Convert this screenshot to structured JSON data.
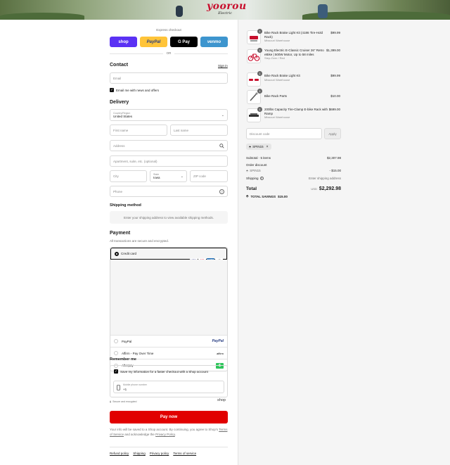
{
  "brand": {
    "name": "yoorou",
    "tagline": "Electric"
  },
  "express": {
    "label": "Express checkout",
    "or": "OR",
    "buttons": [
      {
        "label": "shop",
        "bg": "#5a31f4",
        "fg": "#ffffff"
      },
      {
        "label": "PayPal",
        "bg": "#ffc439",
        "fg": "#253b80"
      },
      {
        "label": "G Pay",
        "bg": "#000000",
        "fg": "#ffffff"
      },
      {
        "label": "venmo",
        "bg": "#3d95ce",
        "fg": "#ffffff"
      }
    ]
  },
  "contact": {
    "title": "Contact",
    "sign_in": "Sign in",
    "email_placeholder": "Email",
    "news_label": "Email me with news and offers"
  },
  "delivery": {
    "title": "Delivery",
    "country_label": "Country/Region",
    "country_value": "United States",
    "first_name": "First name",
    "last_name": "Last name",
    "address": "Address",
    "apartment": "Apartment, suite, etc. (optional)",
    "city": "City",
    "state_label": "State",
    "state_value": "Iowa",
    "zip": "ZIP code",
    "phone": "Phone"
  },
  "shipping_method": {
    "title": "Shipping method",
    "message": "Enter your shipping address to view available shipping methods."
  },
  "payment": {
    "title": "Payment",
    "subtitle": "All transactions are secure and encrypted.",
    "credit_card": "Credit card",
    "card_brands": [
      "VISA",
      "MC",
      "AMEX",
      "+5"
    ],
    "options": [
      {
        "label": "PayPal",
        "logo": "PayPal"
      },
      {
        "label": "Affirm - Pay Over Time",
        "logo": "affirm"
      },
      {
        "label": "Afterpay",
        "logo": "$"
      }
    ]
  },
  "remember": {
    "title": "Remember me",
    "save_label": "Save my information for a faster checkout with a Shop account",
    "phone_label": "Mobile phone number",
    "phone_value": "+1",
    "secure": "Secure and encrypted",
    "shop": "shop"
  },
  "pay": {
    "button": "Pay now",
    "note_1": "Your info will be saved to a Shop account. By continuing, you agree to Shop's",
    "terms_link": "Terms of Service",
    "note_2": "and acknowledge the",
    "privacy_link": "Privacy Policy",
    "note_end": "."
  },
  "footer_links": [
    "Refund policy",
    "Shipping",
    "Privacy policy",
    "Terms of service"
  ],
  "cart": {
    "items": [
      {
        "qty": "1",
        "name": "Bike Rack Brake Light Kit (4186 Tire-Hold Rack)",
        "sub": "Missouri Warehouse",
        "price": "$99.99"
      },
      {
        "qty": "1",
        "name": "Young Electric E-Classic Cruiser 26\" Retro eBike | 500W Motor, Up to 58 miles",
        "sub": "Step-Over / Red",
        "price": "$1,399.00"
      },
      {
        "qty": "1",
        "name": "Bike Rack Brake Light Kit",
        "sub": "Missouri Warehouse",
        "price": "$99.99"
      },
      {
        "qty": "1",
        "name": "Bike Rack Parts",
        "sub": "",
        "price": "$10.00"
      },
      {
        "qty": "1",
        "name": "200lbs Capacity Tire-Clamp E-bike Rack with Ramp",
        "sub": "Missouri Warehouse",
        "price": "$699.00"
      }
    ],
    "discount_placeholder": "Discount code",
    "apply": "Apply",
    "code": "SPIN15",
    "subtotal_label": "Subtotal · 5 items",
    "subtotal_value": "$2,307.98",
    "order_discount_label": "Order discount",
    "discount_code": "SPIN15",
    "discount_value": "- $15.00",
    "shipping_label": "Shipping",
    "shipping_value": "Enter shipping address",
    "total_label": "Total",
    "currency": "USD",
    "total_value": "$2,292.98",
    "savings_label": "TOTAL SAVINGS",
    "savings_value": "$15.00"
  }
}
